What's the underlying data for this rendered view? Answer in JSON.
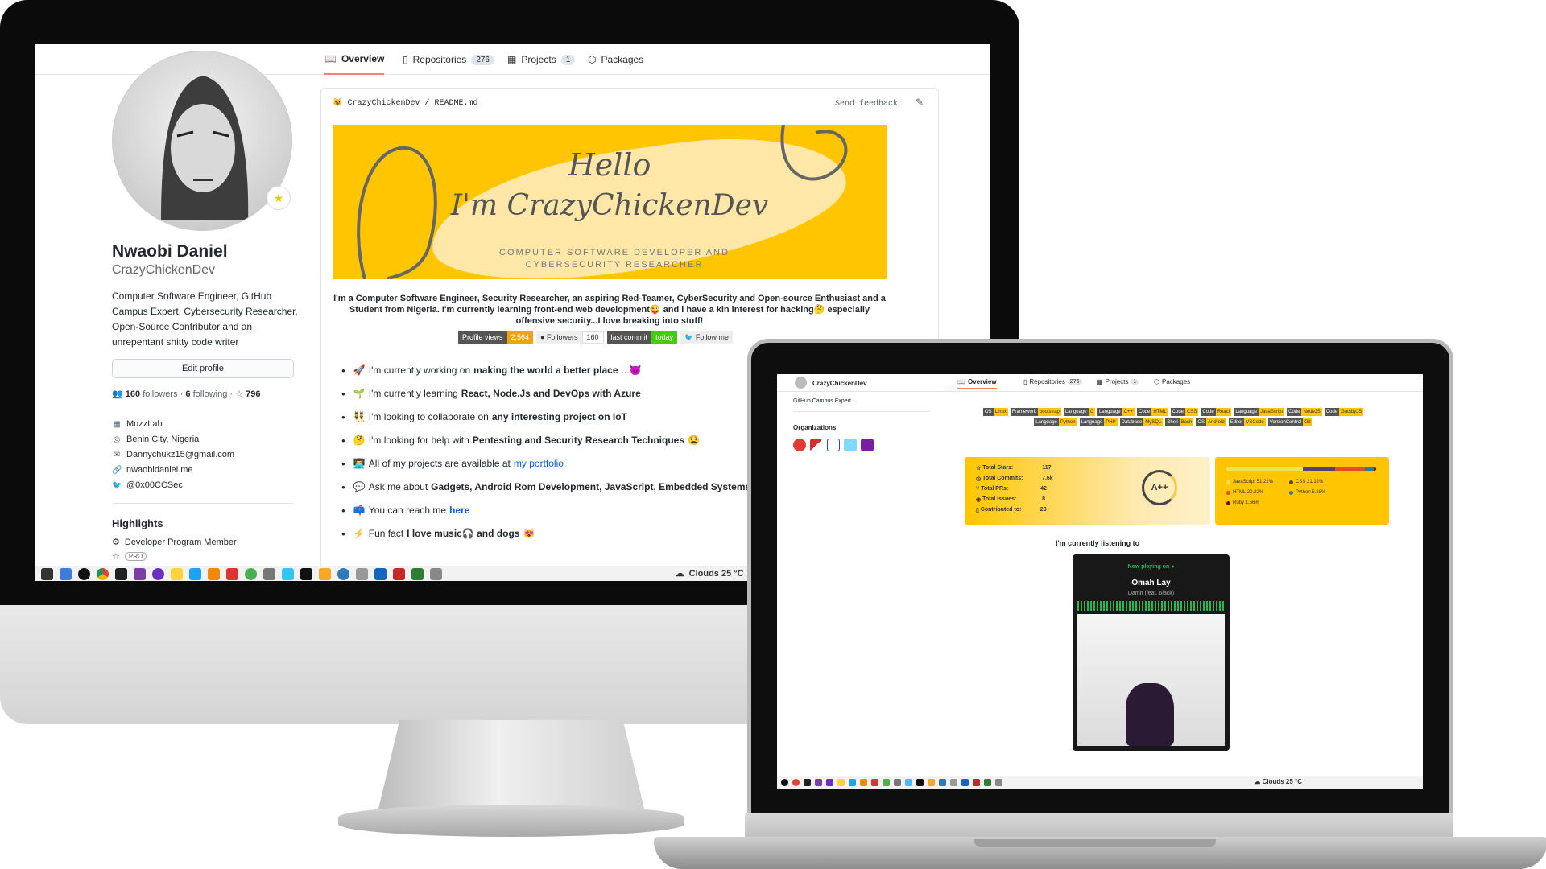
{
  "desktop": {
    "tabs": [
      {
        "label": "Overview",
        "count": ""
      },
      {
        "label": "Repositories",
        "count": "276"
      },
      {
        "label": "Projects",
        "count": "1"
      },
      {
        "label": "Packages",
        "count": ""
      }
    ],
    "profile": {
      "name": "Nwaobi Daniel",
      "login": "CrazyChickenDev",
      "bio": "Computer Software Engineer, GitHub Campus Expert, Cybersecurity Researcher, Open-Source Contributor and an unrepentant shitty code writer",
      "edit_label": "Edit profile",
      "followers": "160",
      "followers_label": "followers",
      "following": "6",
      "following_label": "following",
      "stars": "796",
      "org": "MuzzLab",
      "location": "Benin City, Nigeria",
      "email": "Dannychukz15@gmail.com",
      "website": "nwaobidaniel.me",
      "twitter": "@0x00CCSec"
    },
    "highlights": {
      "title": "Highlights",
      "item1": "Developer Program Member",
      "item2": "PRO"
    },
    "readme": {
      "repo_owner": "CrazyChickenDev",
      "repo_file": "README.md",
      "feedback": "Send feedback",
      "banner_hello": "Hello",
      "banner_name": "I'm CrazyChickenDev",
      "banner_sub": "COMPUTER SOFTWARE DEVELOPER AND CYBERSECURITY RESEARCHER",
      "intro": "I'm a Computer Software Engineer, Security Researcher, an aspiring Red-Teamer, CyberSecurity and Open-source Enthusiast and a Student from Nigeria. I'm currently learning front-end web development😜 and i have a kin interest for hacking🤔 especially offensive security...I love breaking into stuff!",
      "badges": [
        {
          "k": "Profile views",
          "v": "2,564",
          "kc": "#555",
          "vc": "#f0a30a"
        },
        {
          "k": "Followers",
          "v": "160",
          "kc": "#eee",
          "vc": "#eee"
        },
        {
          "k": "last commit",
          "v": "today",
          "kc": "#555",
          "vc": "#4c1"
        },
        {
          "k": "Follow me",
          "v": "",
          "kc": "#eee",
          "vc": "#eee"
        }
      ],
      "items": [
        {
          "icon": "🚀",
          "pre": "I'm currently working on ",
          "bold": "making the world a better place",
          "post": "...😈"
        },
        {
          "icon": "🌱",
          "pre": "I'm currently learning ",
          "bold": "React, Node.Js and DevOps with Azure",
          "post": ""
        },
        {
          "icon": "👯",
          "pre": "I'm looking to collaborate on ",
          "bold": "any interesting project on IoT",
          "post": ""
        },
        {
          "icon": "🤔",
          "pre": "I'm looking for help with ",
          "bold": "Pentesting and Security Research Techniques",
          "post": "😫"
        },
        {
          "icon": "👨‍💻",
          "pre": "All of my projects are available at ",
          "link": "my portfolio",
          "post": ""
        },
        {
          "icon": "💬",
          "pre": "Ask me about ",
          "bold": "Gadgets, Android Rom Development, JavaScript, Embedded Systems, Robo",
          "post": ""
        },
        {
          "icon": "📫",
          "pre": "You can reach me ",
          "link": "here",
          "post": ""
        },
        {
          "icon": "⚡",
          "pre": "Fun fact ",
          "bold": "I love music🎧 and dogs",
          "post": "😻"
        }
      ]
    },
    "taskbar": {
      "weather": "Clouds 25 °C"
    }
  },
  "laptop": {
    "user": "CrazyChickenDev",
    "tabs": [
      {
        "label": "Overview",
        "count": ""
      },
      {
        "label": "Repositories",
        "count": "276"
      },
      {
        "label": "Projects",
        "count": "1"
      },
      {
        "label": "Packages",
        "count": ""
      }
    ],
    "campus": "GitHub Campus Expert",
    "orgs_title": "Organizations",
    "tags": [
      {
        "k": "OS",
        "v": "Linux"
      },
      {
        "k": "Framework",
        "v": "bootstrap"
      },
      {
        "k": "Language",
        "v": "C"
      },
      {
        "k": "Language",
        "v": "C++"
      },
      {
        "k": "Code",
        "v": "HTML"
      },
      {
        "k": "Code",
        "v": "CSS"
      },
      {
        "k": "Code",
        "v": "React"
      },
      {
        "k": "Language",
        "v": "JavaScript"
      },
      {
        "k": "Code",
        "v": "NodeJS"
      },
      {
        "k": "Code",
        "v": "GatsbyJS"
      },
      {
        "k": "Language",
        "v": "Python"
      },
      {
        "k": "Language",
        "v": "PHP"
      },
      {
        "k": "Database",
        "v": "MySQL"
      },
      {
        "k": "Shell",
        "v": "Bash"
      },
      {
        "k": "OS",
        "v": "Android"
      },
      {
        "k": "Editor",
        "v": "VSCode"
      },
      {
        "k": "VersionControl",
        "v": "Git"
      }
    ],
    "stats": {
      "rows": [
        {
          "label": "Total Stars:",
          "value": "117"
        },
        {
          "label": "Total Commits:",
          "value": "7.6k"
        },
        {
          "label": "Total PRs:",
          "value": "42"
        },
        {
          "label": "Total Issues:",
          "value": "8"
        },
        {
          "label": "Contributed to:",
          "value": "23"
        }
      ],
      "grade": "A++"
    },
    "langs": [
      {
        "name": "JavaScript 51.22%",
        "pct": 51.22,
        "color": "#f1e05a"
      },
      {
        "name": "CSS 21.12%",
        "pct": 21.12,
        "color": "#563d7c"
      },
      {
        "name": "HTML 20.22%",
        "pct": 20.22,
        "color": "#e34c26"
      },
      {
        "name": "Python 5.88%",
        "pct": 5.88,
        "color": "#3572A5"
      },
      {
        "name": "Ruby 1.56%",
        "pct": 1.56,
        "color": "#701516"
      }
    ],
    "listening": "I'm currently listening to",
    "spotify": {
      "now": "Now playing on",
      "artist": "Omah Lay",
      "track": "Damn (feat. 6lack)"
    },
    "taskbar": {
      "weather": "Clouds 25 °C"
    }
  }
}
